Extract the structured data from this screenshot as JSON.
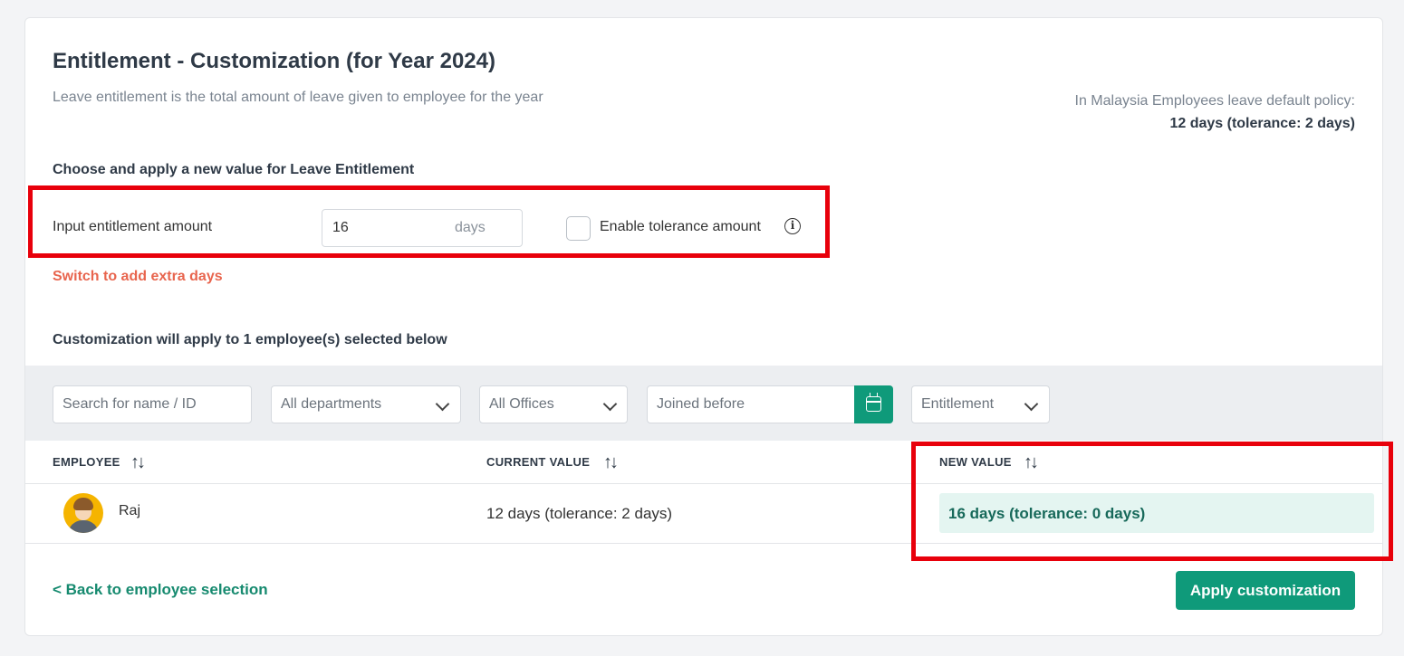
{
  "page": {
    "title": "Entitlement - Customization (for Year 2024)",
    "subtitle": "Leave entitlement is the total amount of leave given to employee for the year",
    "policy_label": "In Malaysia Employees leave default policy:",
    "policy_value": "12 days (tolerance: 2 days)"
  },
  "entitlement_form": {
    "section_label": "Choose and apply a new value for Leave Entitlement",
    "input_label": "Input entitlement amount",
    "amount_value": "16",
    "amount_unit": "days",
    "tolerance_label": "Enable tolerance amount",
    "tolerance_enabled": false,
    "info_glyph": "i",
    "switch_link": "Switch to add extra days"
  },
  "apply_summary": "Customization will apply to 1 employee(s) selected below",
  "filters": {
    "search_placeholder": "Search for name / ID",
    "department": "All departments",
    "office": "All Offices",
    "joined_placeholder": "Joined before",
    "type": "Entitlement"
  },
  "table": {
    "columns": [
      "EMPLOYEE",
      "CURRENT VALUE",
      "NEW VALUE"
    ],
    "sort_glyph": "↑↓",
    "rows": [
      {
        "employee": "Raj",
        "current_value": "12 days (tolerance: 2 days)",
        "new_value": "16 days (tolerance: 0 days)"
      }
    ]
  },
  "footer": {
    "back_link": "< Back to employee selection",
    "apply_button": "Apply customization"
  },
  "colors": {
    "accent": "#0f9a7a",
    "link_warning": "#e8654e",
    "highlight": "#e8000b"
  }
}
